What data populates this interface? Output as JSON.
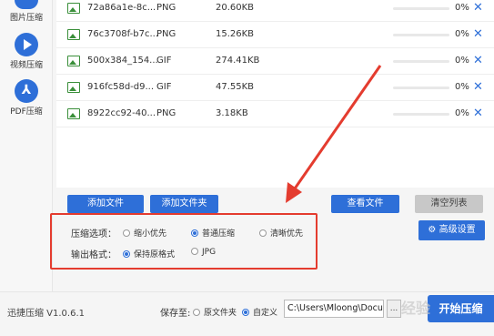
{
  "sidebar": {
    "items": [
      {
        "label": "图片压缩",
        "icon": "image-compress-icon"
      },
      {
        "label": "视频压缩",
        "icon": "play-icon"
      },
      {
        "label": "PDF压缩",
        "icon": "pdf-icon"
      }
    ]
  },
  "files": [
    {
      "name": "72a86a1e-8c...",
      "type": "PNG",
      "size": "20.60KB",
      "progress": "0%",
      "delete": "✕"
    },
    {
      "name": "76c3708f-b7c...",
      "type": "PNG",
      "size": "15.26KB",
      "progress": "0%",
      "delete": "✕"
    },
    {
      "name": "500x384_154...",
      "type": "GIF",
      "size": "274.41KB",
      "progress": "0%",
      "delete": "✕"
    },
    {
      "name": "916fc58d-d9...",
      "type": "GIF",
      "size": "47.55KB",
      "progress": "0%",
      "delete": "✕"
    },
    {
      "name": "8922cc92-40...",
      "type": "PNG",
      "size": "3.18KB",
      "progress": "0%",
      "delete": "✕"
    }
  ],
  "toolbar": {
    "add_file": "添加文件",
    "add_folder": "添加文件夹",
    "view_files": "查看文件",
    "clear_list": "清空列表",
    "advanced": "高级设置"
  },
  "options": {
    "compress_label": "压缩选项：",
    "compress_choices": [
      "缩小优先",
      "普通压缩",
      "清晰优先"
    ],
    "compress_selected": "普通压缩",
    "format_label": "输出格式：",
    "format_choices": [
      "保持原格式",
      "JPG"
    ],
    "format_selected": "保持原格式"
  },
  "footer": {
    "version": "迅捷压缩 V1.0.6.1",
    "save_to": "保存至:",
    "original_folder": "原文件夹",
    "custom": "自定义",
    "path": "C:\\Users\\Mloong\\Docum",
    "folder_button": "...",
    "start": "开始压缩",
    "watermark": "经验"
  },
  "colors": {
    "accent": "#2e6fd8",
    "annotation": "#e43c2f",
    "file_icon": "#3a8f3a"
  }
}
